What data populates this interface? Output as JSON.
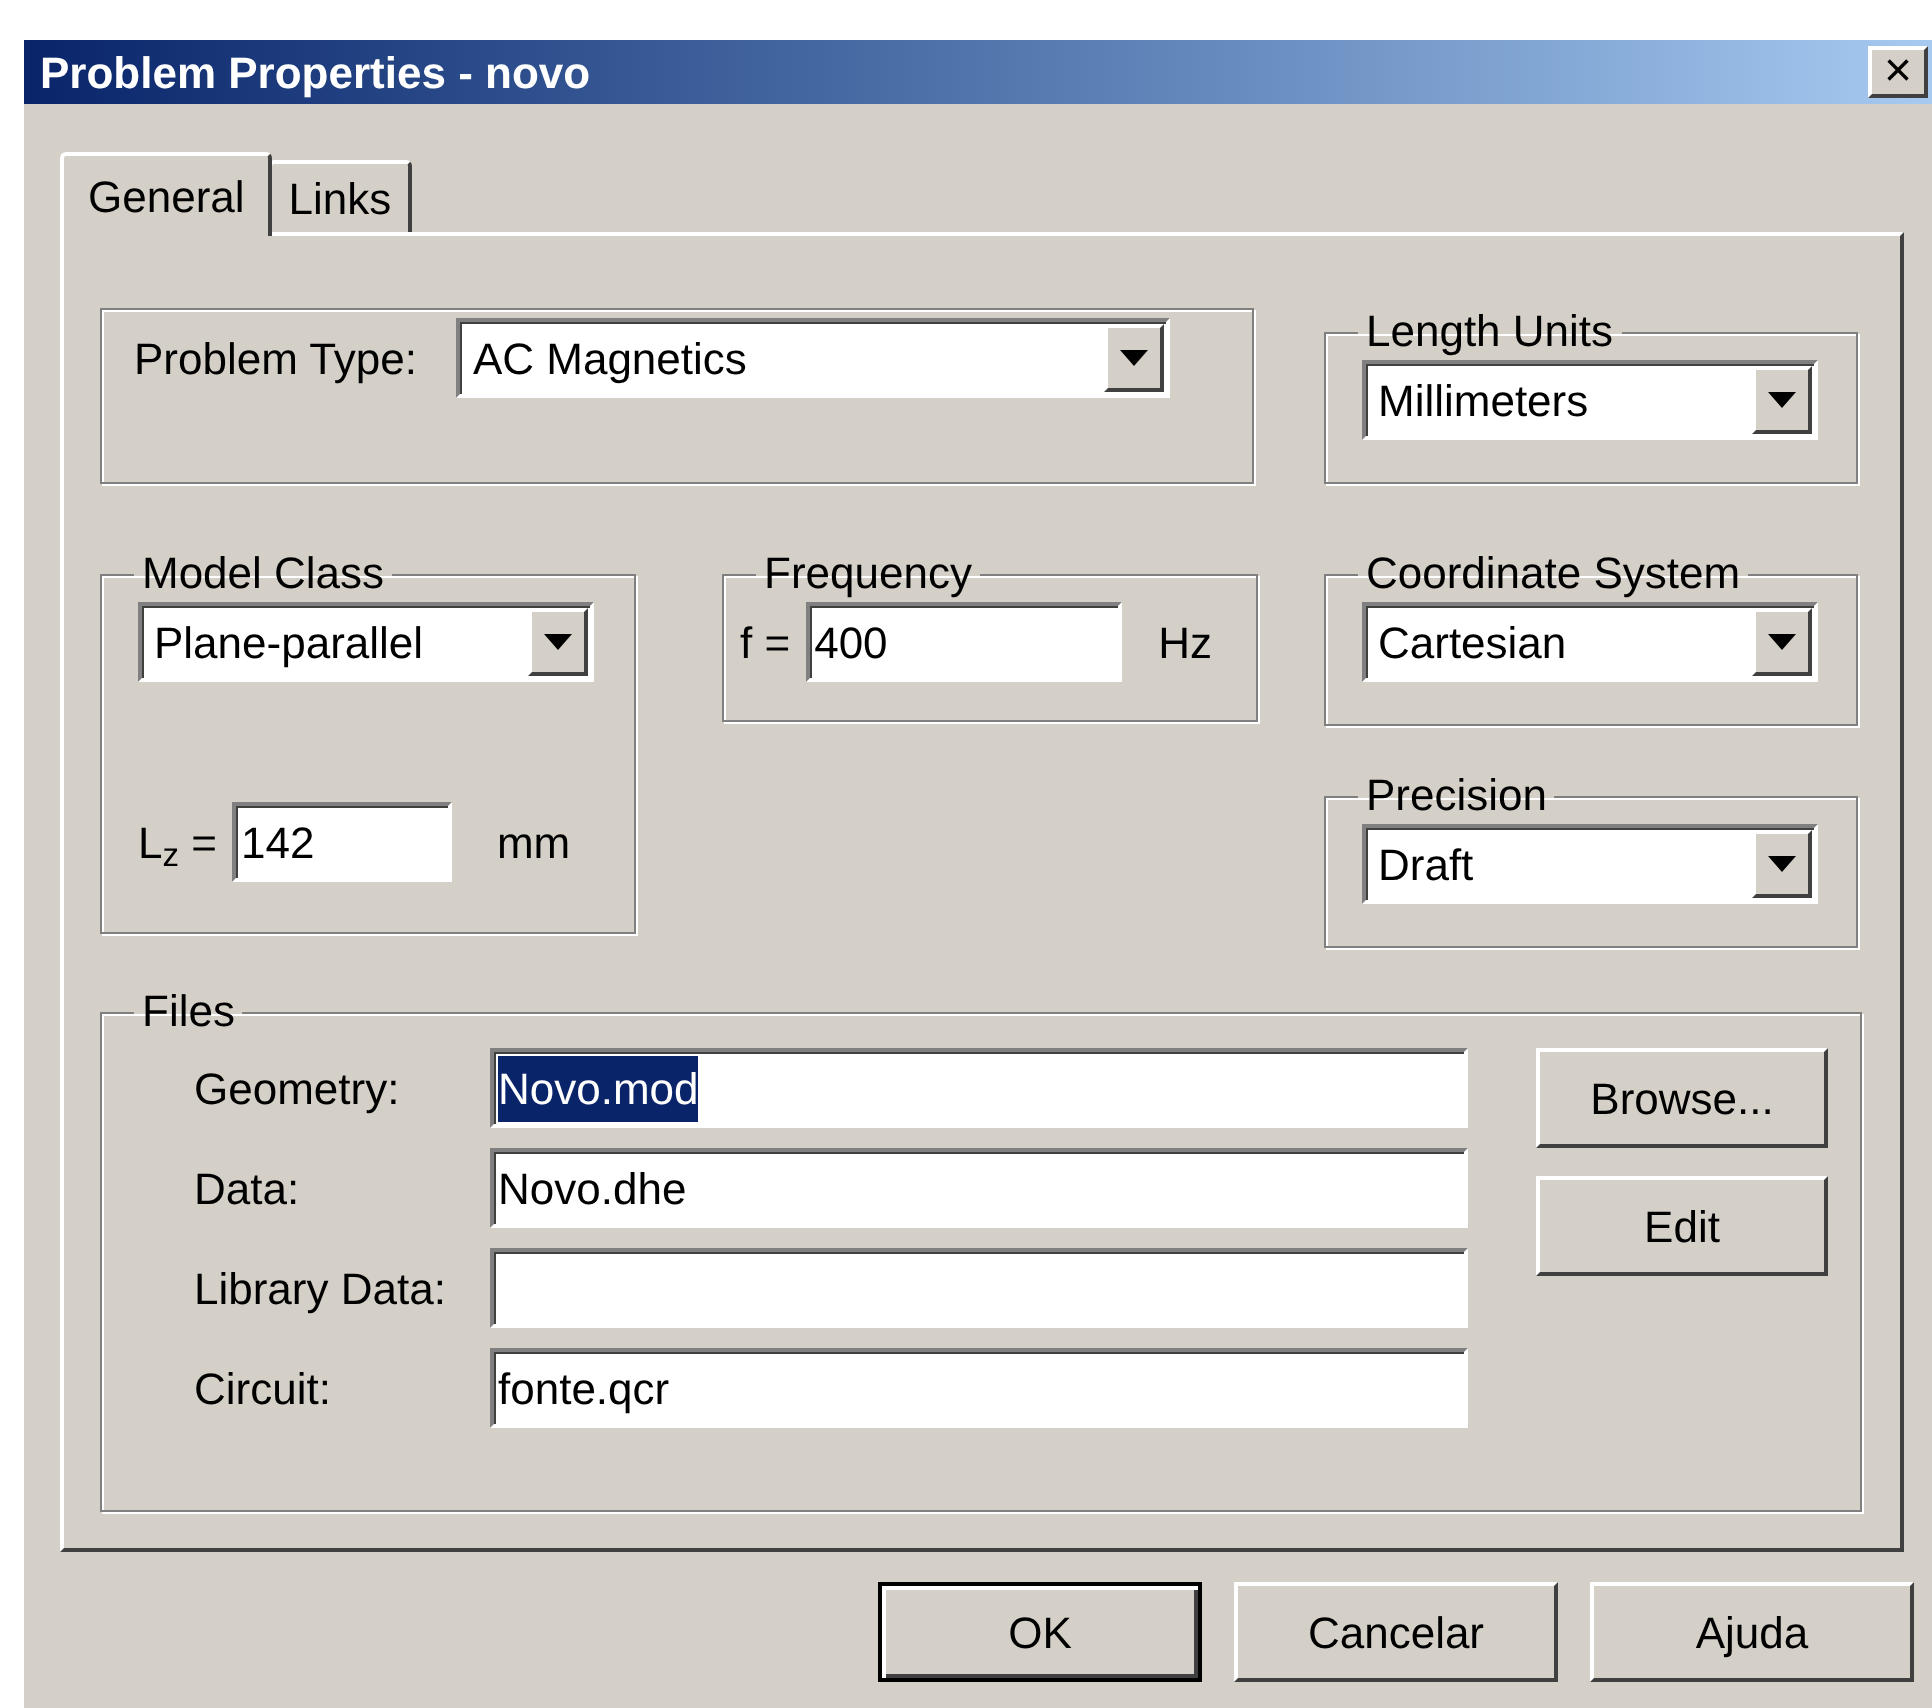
{
  "window": {
    "title": "Problem Properties - novo",
    "close": "×"
  },
  "tabs": [
    {
      "label": "General",
      "selected": true
    },
    {
      "label": "Links",
      "selected": false
    }
  ],
  "problem_type": {
    "label": "Problem Type:",
    "value": "AC Magnetics"
  },
  "length_units": {
    "legend": "Length Units",
    "value": "Millimeters"
  },
  "model_class": {
    "legend": "Model Class",
    "value": "Plane-parallel",
    "depth_label": "L$_{z}$ =",
    "depth_value": "142",
    "depth_unit": "mm"
  },
  "frequency": {
    "legend": "Frequency",
    "label": "f =",
    "value": "400",
    "unit": "Hz"
  },
  "coordinate_system": {
    "legend": "Coordinate System",
    "value": "Cartesian"
  },
  "precision": {
    "legend": "Precision",
    "value": "Draft"
  },
  "files": {
    "legend": "Files",
    "fields": [
      {
        "label": "Geometry:",
        "value": "Novo.mod",
        "selected": true
      },
      {
        "label": "Data:",
        "value": "Novo.dhe",
        "selected": false
      },
      {
        "label": "Library Data:",
        "selected": false
      },
      {
        "label": "Circuit:",
        "value": "fonte.qcr",
        "selected": false
      }
    ],
    "buttons": [
      "Browse...",
      "Edit"
    ]
  },
  "buttons": [
    {
      "label": "OK",
      "default": true
    },
    {
      "label": "Cancelar",
      "default": false
    },
    {
      "label": "Ajuda",
      "default": false
    }
  ]
}
